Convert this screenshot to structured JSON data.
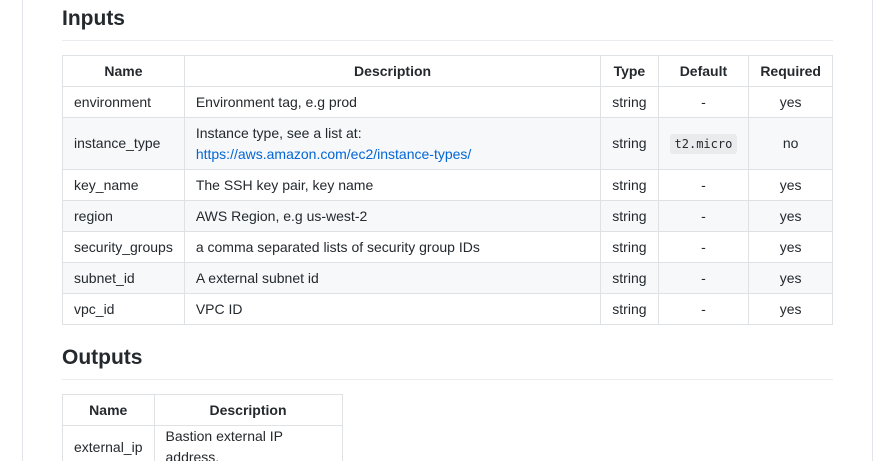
{
  "inputs": {
    "heading": "Inputs",
    "headers": {
      "name": "Name",
      "description": "Description",
      "type": "Type",
      "default": "Default",
      "required": "Required"
    },
    "rows": [
      {
        "name": "environment",
        "description": "Environment tag, e.g prod",
        "type": "string",
        "default": "-",
        "required": "yes"
      },
      {
        "name": "instance_type",
        "description": "Instance type, see a list at: ",
        "link": "https://aws.amazon.com/ec2/instance-types/",
        "type": "string",
        "default": "t2.micro",
        "required": "no"
      },
      {
        "name": "key_name",
        "description": "The SSH key pair, key name",
        "type": "string",
        "default": "-",
        "required": "yes"
      },
      {
        "name": "region",
        "description": "AWS Region, e.g us-west-2",
        "type": "string",
        "default": "-",
        "required": "yes"
      },
      {
        "name": "security_groups",
        "description": "a comma separated lists of security group IDs",
        "type": "string",
        "default": "-",
        "required": "yes"
      },
      {
        "name": "subnet_id",
        "description": "A external subnet id",
        "type": "string",
        "default": "-",
        "required": "yes"
      },
      {
        "name": "vpc_id",
        "description": "VPC ID",
        "type": "string",
        "default": "-",
        "required": "yes"
      }
    ]
  },
  "outputs": {
    "heading": "Outputs",
    "headers": {
      "name": "Name",
      "description": "Description"
    },
    "rows": [
      {
        "name": "external_ip",
        "description": "Bastion external IP address."
      }
    ]
  },
  "colors": {
    "link": "#0366d6",
    "alt_row": "#f6f8fa",
    "border": "#dfe2e5"
  }
}
